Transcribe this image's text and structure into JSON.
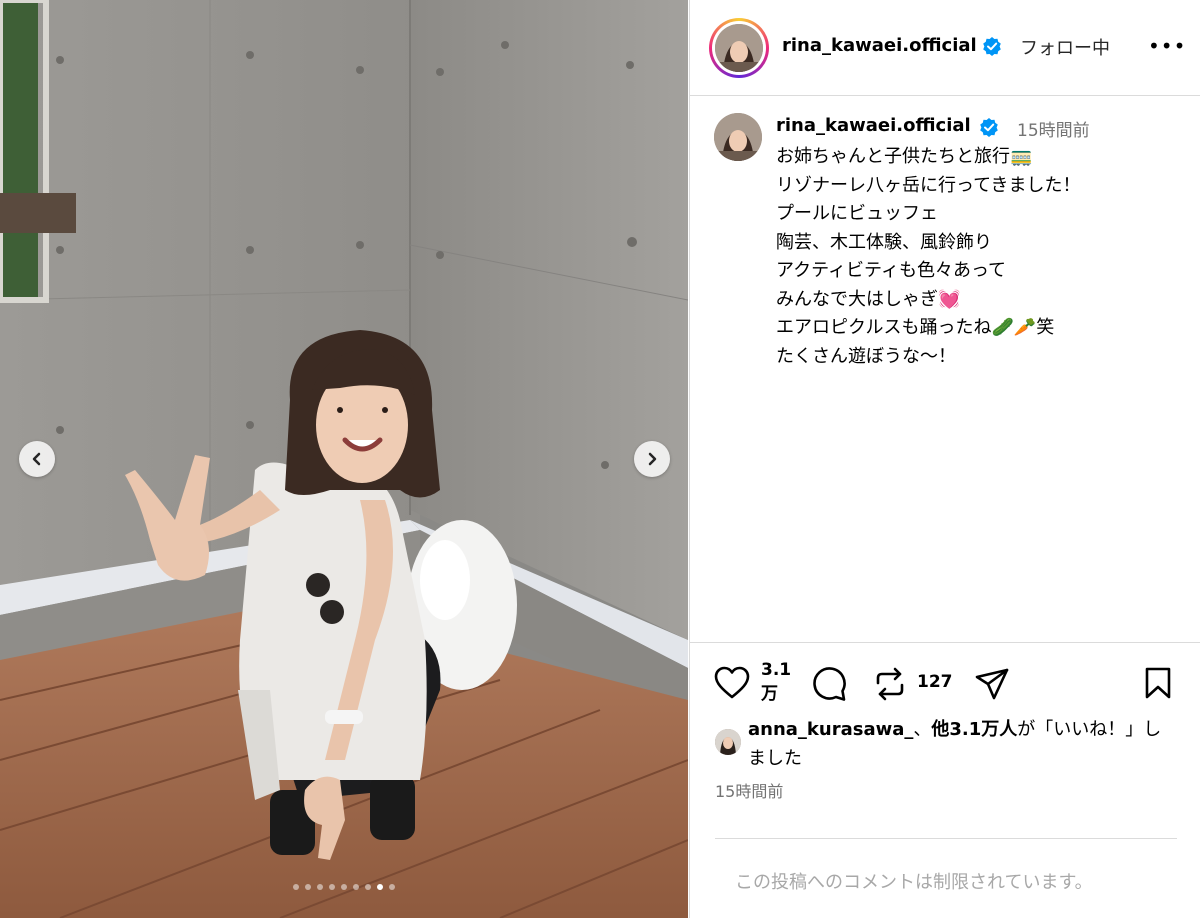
{
  "post": {
    "username": "rina_kawaei.official",
    "follow_status": "フォロー中",
    "more_label": "•••",
    "caption_time": "15時間前",
    "caption_lines": [
      "お姉ちゃんと子供たちと旅行🚃",
      "リゾナーレ八ヶ岳に行ってきました！",
      "プールにビュッフェ",
      "陶芸、木工体験、風鈴飾り",
      "アクティビティも色々あって",
      "みんなで大はしゃぎ💓",
      "エアロピクルスも踊ったね🥒🥕笑",
      "たくさん遊ぼうな〜！"
    ],
    "like_count_line1": "3.1",
    "like_count_line2": "万",
    "repost_count": "127",
    "liked_by_user": "anna_kurasawa_",
    "liked_by_text_mid": "、",
    "liked_by_others": "他3.1万人",
    "liked_by_text_end": "が「いいね！」しました",
    "post_time": "15時間前",
    "comments_restricted": "この投稿へのコメントは制限されています。"
  },
  "carousel": {
    "total_slides": 9,
    "active_index": 7
  },
  "icons": {
    "verified": "verified-badge-icon",
    "like": "heart-icon",
    "comment": "speech-bubble-icon",
    "repost": "repost-icon",
    "share": "paper-plane-icon",
    "save": "bookmark-icon",
    "prev": "chevron-left-icon",
    "next": "chevron-right-icon"
  },
  "colors": {
    "verified_blue": "#0095f6",
    "secondary_text": "#737373",
    "muted_text": "#a8a8a8",
    "border": "#dbdbdb"
  }
}
